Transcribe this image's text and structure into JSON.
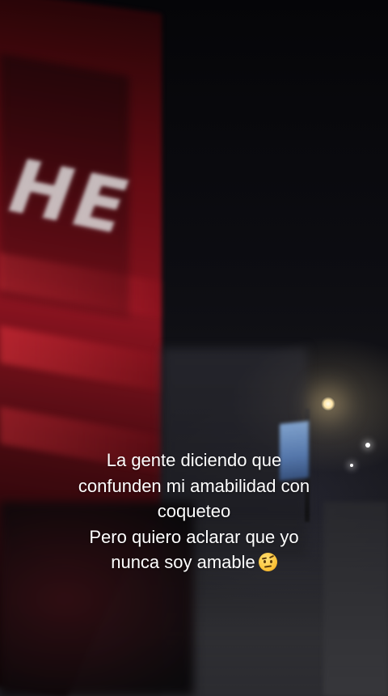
{
  "caption": {
    "lines": [
      "La gente diciendo que",
      "confunden mi amabilidad con",
      "coqueteo",
      "Pero quiero aclarar que yo",
      "nunca soy amable"
    ],
    "emoji": "face-with-raised-eyebrow-icon"
  },
  "background": {
    "sign_text": "HE"
  },
  "colors": {
    "caption_text": "#ffffff",
    "facade_red": "#8f1420",
    "streetlight": "#ffe6a8",
    "sky": "#050508"
  }
}
